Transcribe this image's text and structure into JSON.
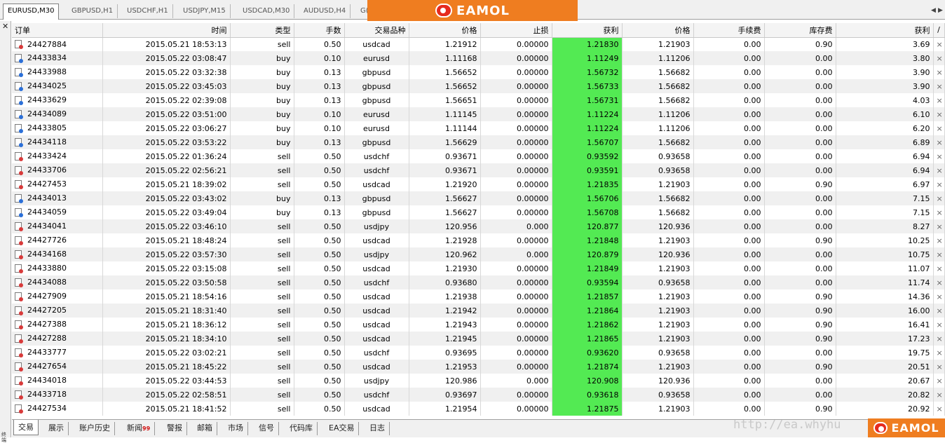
{
  "chart_tabs": [
    "EURUSD,M30",
    "GBPUSD,H1",
    "USDCHF,H1",
    "USDJPY,M15",
    "USDCAD,M30",
    "AUDUSD,H4",
    "G("
  ],
  "brand": "EAMOL",
  "side": {
    "close_symbol": "✕",
    "label": "终端"
  },
  "table": {
    "headers": [
      "订单",
      "时间",
      "类型",
      "手数",
      "交易品种",
      "价格",
      "止损",
      "获利",
      "价格",
      "手续费",
      "库存费",
      "获利",
      "/"
    ],
    "rows": [
      {
        "ticket": "24427884",
        "time": "2015.05.21 18:53:13",
        "type": "sell",
        "lots": "0.50",
        "symbol": "usdcad",
        "price": "1.21912",
        "sl": "0.00000",
        "tp": "1.21830",
        "cur": "1.21903",
        "comm": "0.00",
        "swap": "0.90",
        "profit": "3.69"
      },
      {
        "ticket": "24433834",
        "time": "2015.05.22 03:08:47",
        "type": "buy",
        "lots": "0.10",
        "symbol": "eurusd",
        "price": "1.11168",
        "sl": "0.00000",
        "tp": "1.11249",
        "cur": "1.11206",
        "comm": "0.00",
        "swap": "0.00",
        "profit": "3.80"
      },
      {
        "ticket": "24433988",
        "time": "2015.05.22 03:32:38",
        "type": "buy",
        "lots": "0.13",
        "symbol": "gbpusd",
        "price": "1.56652",
        "sl": "0.00000",
        "tp": "1.56732",
        "cur": "1.56682",
        "comm": "0.00",
        "swap": "0.00",
        "profit": "3.90"
      },
      {
        "ticket": "24434025",
        "time": "2015.05.22 03:45:03",
        "type": "buy",
        "lots": "0.13",
        "symbol": "gbpusd",
        "price": "1.56652",
        "sl": "0.00000",
        "tp": "1.56733",
        "cur": "1.56682",
        "comm": "0.00",
        "swap": "0.00",
        "profit": "3.90"
      },
      {
        "ticket": "24433629",
        "time": "2015.05.22 02:39:08",
        "type": "buy",
        "lots": "0.13",
        "symbol": "gbpusd",
        "price": "1.56651",
        "sl": "0.00000",
        "tp": "1.56731",
        "cur": "1.56682",
        "comm": "0.00",
        "swap": "0.00",
        "profit": "4.03"
      },
      {
        "ticket": "24434089",
        "time": "2015.05.22 03:51:00",
        "type": "buy",
        "lots": "0.10",
        "symbol": "eurusd",
        "price": "1.11145",
        "sl": "0.00000",
        "tp": "1.11224",
        "cur": "1.11206",
        "comm": "0.00",
        "swap": "0.00",
        "profit": "6.10"
      },
      {
        "ticket": "24433805",
        "time": "2015.05.22 03:06:27",
        "type": "buy",
        "lots": "0.10",
        "symbol": "eurusd",
        "price": "1.11144",
        "sl": "0.00000",
        "tp": "1.11224",
        "cur": "1.11206",
        "comm": "0.00",
        "swap": "0.00",
        "profit": "6.20"
      },
      {
        "ticket": "24434118",
        "time": "2015.05.22 03:53:22",
        "type": "buy",
        "lots": "0.13",
        "symbol": "gbpusd",
        "price": "1.56629",
        "sl": "0.00000",
        "tp": "1.56707",
        "cur": "1.56682",
        "comm": "0.00",
        "swap": "0.00",
        "profit": "6.89"
      },
      {
        "ticket": "24433424",
        "time": "2015.05.22 01:36:24",
        "type": "sell",
        "lots": "0.50",
        "symbol": "usdchf",
        "price": "0.93671",
        "sl": "0.00000",
        "tp": "0.93592",
        "cur": "0.93658",
        "comm": "0.00",
        "swap": "0.00",
        "profit": "6.94"
      },
      {
        "ticket": "24433706",
        "time": "2015.05.22 02:56:21",
        "type": "sell",
        "lots": "0.50",
        "symbol": "usdchf",
        "price": "0.93671",
        "sl": "0.00000",
        "tp": "0.93591",
        "cur": "0.93658",
        "comm": "0.00",
        "swap": "0.00",
        "profit": "6.94"
      },
      {
        "ticket": "24427453",
        "time": "2015.05.21 18:39:02",
        "type": "sell",
        "lots": "0.50",
        "symbol": "usdcad",
        "price": "1.21920",
        "sl": "0.00000",
        "tp": "1.21835",
        "cur": "1.21903",
        "comm": "0.00",
        "swap": "0.90",
        "profit": "6.97"
      },
      {
        "ticket": "24434013",
        "time": "2015.05.22 03:43:02",
        "type": "buy",
        "lots": "0.13",
        "symbol": "gbpusd",
        "price": "1.56627",
        "sl": "0.00000",
        "tp": "1.56706",
        "cur": "1.56682",
        "comm": "0.00",
        "swap": "0.00",
        "profit": "7.15"
      },
      {
        "ticket": "24434059",
        "time": "2015.05.22 03:49:04",
        "type": "buy",
        "lots": "0.13",
        "symbol": "gbpusd",
        "price": "1.56627",
        "sl": "0.00000",
        "tp": "1.56708",
        "cur": "1.56682",
        "comm": "0.00",
        "swap": "0.00",
        "profit": "7.15"
      },
      {
        "ticket": "24434041",
        "time": "2015.05.22 03:46:10",
        "type": "sell",
        "lots": "0.50",
        "symbol": "usdjpy",
        "price": "120.956",
        "sl": "0.000",
        "tp": "120.877",
        "cur": "120.936",
        "comm": "0.00",
        "swap": "0.00",
        "profit": "8.27"
      },
      {
        "ticket": "24427726",
        "time": "2015.05.21 18:48:24",
        "type": "sell",
        "lots": "0.50",
        "symbol": "usdcad",
        "price": "1.21928",
        "sl": "0.00000",
        "tp": "1.21848",
        "cur": "1.21903",
        "comm": "0.00",
        "swap": "0.90",
        "profit": "10.25"
      },
      {
        "ticket": "24434168",
        "time": "2015.05.22 03:57:30",
        "type": "sell",
        "lots": "0.50",
        "symbol": "usdjpy",
        "price": "120.962",
        "sl": "0.000",
        "tp": "120.879",
        "cur": "120.936",
        "comm": "0.00",
        "swap": "0.00",
        "profit": "10.75"
      },
      {
        "ticket": "24433880",
        "time": "2015.05.22 03:15:08",
        "type": "sell",
        "lots": "0.50",
        "symbol": "usdcad",
        "price": "1.21930",
        "sl": "0.00000",
        "tp": "1.21849",
        "cur": "1.21903",
        "comm": "0.00",
        "swap": "0.00",
        "profit": "11.07"
      },
      {
        "ticket": "24434088",
        "time": "2015.05.22 03:50:58",
        "type": "sell",
        "lots": "0.50",
        "symbol": "usdchf",
        "price": "0.93680",
        "sl": "0.00000",
        "tp": "0.93594",
        "cur": "0.93658",
        "comm": "0.00",
        "swap": "0.00",
        "profit": "11.74"
      },
      {
        "ticket": "24427909",
        "time": "2015.05.21 18:54:16",
        "type": "sell",
        "lots": "0.50",
        "symbol": "usdcad",
        "price": "1.21938",
        "sl": "0.00000",
        "tp": "1.21857",
        "cur": "1.21903",
        "comm": "0.00",
        "swap": "0.90",
        "profit": "14.36"
      },
      {
        "ticket": "24427205",
        "time": "2015.05.21 18:31:40",
        "type": "sell",
        "lots": "0.50",
        "symbol": "usdcad",
        "price": "1.21942",
        "sl": "0.00000",
        "tp": "1.21864",
        "cur": "1.21903",
        "comm": "0.00",
        "swap": "0.90",
        "profit": "16.00"
      },
      {
        "ticket": "24427388",
        "time": "2015.05.21 18:36:12",
        "type": "sell",
        "lots": "0.50",
        "symbol": "usdcad",
        "price": "1.21943",
        "sl": "0.00000",
        "tp": "1.21862",
        "cur": "1.21903",
        "comm": "0.00",
        "swap": "0.90",
        "profit": "16.41"
      },
      {
        "ticket": "24427288",
        "time": "2015.05.21 18:34:10",
        "type": "sell",
        "lots": "0.50",
        "symbol": "usdcad",
        "price": "1.21945",
        "sl": "0.00000",
        "tp": "1.21865",
        "cur": "1.21903",
        "comm": "0.00",
        "swap": "0.90",
        "profit": "17.23"
      },
      {
        "ticket": "24433777",
        "time": "2015.05.22 03:02:21",
        "type": "sell",
        "lots": "0.50",
        "symbol": "usdchf",
        "price": "0.93695",
        "sl": "0.00000",
        "tp": "0.93620",
        "cur": "0.93658",
        "comm": "0.00",
        "swap": "0.00",
        "profit": "19.75"
      },
      {
        "ticket": "24427654",
        "time": "2015.05.21 18:45:22",
        "type": "sell",
        "lots": "0.50",
        "symbol": "usdcad",
        "price": "1.21953",
        "sl": "0.00000",
        "tp": "1.21874",
        "cur": "1.21903",
        "comm": "0.00",
        "swap": "0.90",
        "profit": "20.51"
      },
      {
        "ticket": "24434018",
        "time": "2015.05.22 03:44:53",
        "type": "sell",
        "lots": "0.50",
        "symbol": "usdjpy",
        "price": "120.986",
        "sl": "0.000",
        "tp": "120.908",
        "cur": "120.936",
        "comm": "0.00",
        "swap": "0.00",
        "profit": "20.67"
      },
      {
        "ticket": "24433718",
        "time": "2015.05.22 02:58:51",
        "type": "sell",
        "lots": "0.50",
        "symbol": "usdchf",
        "price": "0.93697",
        "sl": "0.00000",
        "tp": "0.93618",
        "cur": "0.93658",
        "comm": "0.00",
        "swap": "0.00",
        "profit": "20.82"
      },
      {
        "ticket": "24427534",
        "time": "2015.05.21 18:41:52",
        "type": "sell",
        "lots": "0.50",
        "symbol": "usdcad",
        "price": "1.21954",
        "sl": "0.00000",
        "tp": "1.21875",
        "cur": "1.21903",
        "comm": "0.00",
        "swap": "0.90",
        "profit": "20.92"
      }
    ],
    "close_symbol": "×"
  },
  "bottom_tabs": [
    {
      "label": "交易",
      "badge": ""
    },
    {
      "label": "展示",
      "badge": ""
    },
    {
      "label": "账户历史",
      "badge": ""
    },
    {
      "label": "新闻",
      "badge": "99"
    },
    {
      "label": "警报",
      "badge": ""
    },
    {
      "label": "邮箱",
      "badge": ""
    },
    {
      "label": "市场",
      "badge": ""
    },
    {
      "label": "信号",
      "badge": ""
    },
    {
      "label": "代码库",
      "badge": ""
    },
    {
      "label": "EA交易",
      "badge": ""
    },
    {
      "label": "日志",
      "badge": ""
    }
  ],
  "watermark": "http://ea.whyhu",
  "colors": {
    "tp_highlight": "#53ea53",
    "brand": "#ef7d20",
    "sell_icon": "#d83a3a",
    "buy_icon": "#2a6fd8"
  }
}
